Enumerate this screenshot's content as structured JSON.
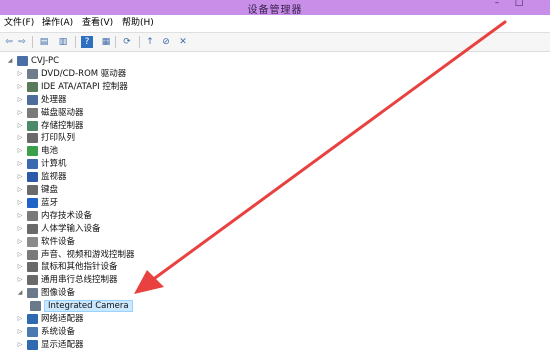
{
  "window": {
    "title": "设备管理器",
    "controls": [
      "–",
      "□"
    ]
  },
  "menu": [
    "文件(F)",
    "操作(A)",
    "查看(V)",
    "帮助(H)"
  ],
  "toolbar": [
    {
      "icon": "back-arrow-icon",
      "glyph": "⇦"
    },
    {
      "icon": "forward-arrow-icon",
      "glyph": "⇨"
    },
    {
      "icon": "properties-panel-icon",
      "glyph": "▤"
    },
    {
      "icon": "document-icon",
      "glyph": "▥"
    },
    {
      "icon": "help-icon",
      "glyph": "?"
    },
    {
      "icon": "console-tree-icon",
      "glyph": "▦"
    },
    {
      "icon": "scan-hardware-icon",
      "glyph": "⟳"
    },
    {
      "icon": "update-driver-icon",
      "glyph": "↑"
    },
    {
      "icon": "disable-device-icon",
      "glyph": "⊘"
    },
    {
      "icon": "uninstall-icon",
      "glyph": "✕"
    }
  ],
  "tree": {
    "root": "CVJ-PC",
    "items": [
      {
        "label": "DVD/CD-ROM 驱动器",
        "icon": "dvd-drive-icon",
        "color": "#6f7c8c"
      },
      {
        "label": "IDE ATA/ATAPI 控制器",
        "icon": "ide-controller-icon",
        "color": "#5a7b5a"
      },
      {
        "label": "处理器",
        "icon": "processor-icon",
        "color": "#4d6d9a"
      },
      {
        "label": "磁盘驱动器",
        "icon": "disk-drive-icon",
        "color": "#7a7a7a"
      },
      {
        "label": "存储控制器",
        "icon": "storage-controller-icon",
        "color": "#4c8a6a"
      },
      {
        "label": "打印队列",
        "icon": "printer-icon",
        "color": "#6a6a6a"
      },
      {
        "label": "电池",
        "icon": "battery-icon",
        "color": "#3aa04a"
      },
      {
        "label": "计算机",
        "icon": "computer-icon",
        "color": "#3a6ab0"
      },
      {
        "label": "监视器",
        "icon": "monitor-icon",
        "color": "#2d5aa8"
      },
      {
        "label": "键盘",
        "icon": "keyboard-icon",
        "color": "#6a6a6a"
      },
      {
        "label": "蓝牙",
        "icon": "bluetooth-icon",
        "color": "#1f63c8"
      },
      {
        "label": "内存技术设备",
        "icon": "memory-device-icon",
        "color": "#7a7a7a"
      },
      {
        "label": "人体学输入设备",
        "icon": "hid-icon",
        "color": "#6a6a6a"
      },
      {
        "label": "软件设备",
        "icon": "software-device-icon",
        "color": "#8a8a8a"
      },
      {
        "label": "声音、视频和游戏控制器",
        "icon": "sound-icon",
        "color": "#7a7a7a"
      },
      {
        "label": "鼠标和其他指针设备",
        "icon": "mouse-icon",
        "color": "#6a6a6a"
      },
      {
        "label": "通用串行总线控制器",
        "icon": "usb-icon",
        "color": "#6a6a6a"
      },
      {
        "label": "图像设备",
        "icon": "imaging-device-icon",
        "color": "#6a7a8a",
        "expanded": true
      },
      {
        "label": "Integrated Camera",
        "icon": "camera-icon",
        "color": "#6a7a8a",
        "child": true,
        "selected": true
      },
      {
        "label": "网络适配器",
        "icon": "network-adapter-icon",
        "color": "#2d6ab0"
      },
      {
        "label": "系统设备",
        "icon": "system-device-icon",
        "color": "#4a7ab0"
      },
      {
        "label": "显示适配器",
        "icon": "display-adapter-icon",
        "color": "#2d6ab0"
      }
    ]
  },
  "colors": {
    "titlebar": "#c98ee8",
    "selection_bg": "#cce8ff",
    "annotation_arrow": "#e8413f"
  }
}
